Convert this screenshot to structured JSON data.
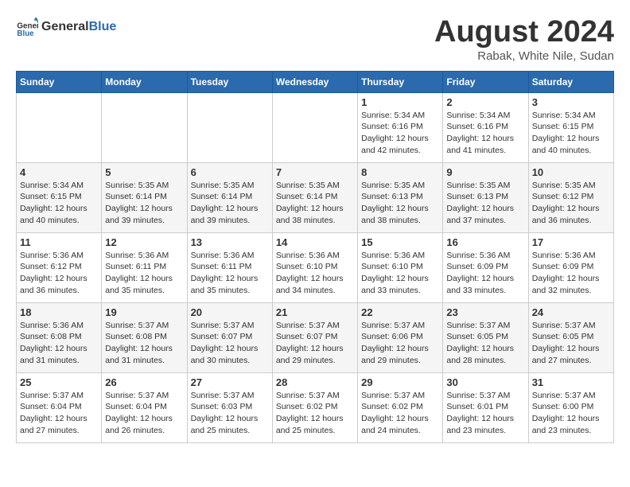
{
  "header": {
    "logo_general": "General",
    "logo_blue": "Blue",
    "month_year": "August 2024",
    "location": "Rabak, White Nile, Sudan"
  },
  "weekdays": [
    "Sunday",
    "Monday",
    "Tuesday",
    "Wednesday",
    "Thursday",
    "Friday",
    "Saturday"
  ],
  "weeks": [
    [
      {
        "day": "",
        "info": ""
      },
      {
        "day": "",
        "info": ""
      },
      {
        "day": "",
        "info": ""
      },
      {
        "day": "",
        "info": ""
      },
      {
        "day": "1",
        "info": "Sunrise: 5:34 AM\nSunset: 6:16 PM\nDaylight: 12 hours\nand 42 minutes."
      },
      {
        "day": "2",
        "info": "Sunrise: 5:34 AM\nSunset: 6:16 PM\nDaylight: 12 hours\nand 41 minutes."
      },
      {
        "day": "3",
        "info": "Sunrise: 5:34 AM\nSunset: 6:15 PM\nDaylight: 12 hours\nand 40 minutes."
      }
    ],
    [
      {
        "day": "4",
        "info": "Sunrise: 5:34 AM\nSunset: 6:15 PM\nDaylight: 12 hours\nand 40 minutes."
      },
      {
        "day": "5",
        "info": "Sunrise: 5:35 AM\nSunset: 6:14 PM\nDaylight: 12 hours\nand 39 minutes."
      },
      {
        "day": "6",
        "info": "Sunrise: 5:35 AM\nSunset: 6:14 PM\nDaylight: 12 hours\nand 39 minutes."
      },
      {
        "day": "7",
        "info": "Sunrise: 5:35 AM\nSunset: 6:14 PM\nDaylight: 12 hours\nand 38 minutes."
      },
      {
        "day": "8",
        "info": "Sunrise: 5:35 AM\nSunset: 6:13 PM\nDaylight: 12 hours\nand 38 minutes."
      },
      {
        "day": "9",
        "info": "Sunrise: 5:35 AM\nSunset: 6:13 PM\nDaylight: 12 hours\nand 37 minutes."
      },
      {
        "day": "10",
        "info": "Sunrise: 5:35 AM\nSunset: 6:12 PM\nDaylight: 12 hours\nand 36 minutes."
      }
    ],
    [
      {
        "day": "11",
        "info": "Sunrise: 5:36 AM\nSunset: 6:12 PM\nDaylight: 12 hours\nand 36 minutes."
      },
      {
        "day": "12",
        "info": "Sunrise: 5:36 AM\nSunset: 6:11 PM\nDaylight: 12 hours\nand 35 minutes."
      },
      {
        "day": "13",
        "info": "Sunrise: 5:36 AM\nSunset: 6:11 PM\nDaylight: 12 hours\nand 35 minutes."
      },
      {
        "day": "14",
        "info": "Sunrise: 5:36 AM\nSunset: 6:10 PM\nDaylight: 12 hours\nand 34 minutes."
      },
      {
        "day": "15",
        "info": "Sunrise: 5:36 AM\nSunset: 6:10 PM\nDaylight: 12 hours\nand 33 minutes."
      },
      {
        "day": "16",
        "info": "Sunrise: 5:36 AM\nSunset: 6:09 PM\nDaylight: 12 hours\nand 33 minutes."
      },
      {
        "day": "17",
        "info": "Sunrise: 5:36 AM\nSunset: 6:09 PM\nDaylight: 12 hours\nand 32 minutes."
      }
    ],
    [
      {
        "day": "18",
        "info": "Sunrise: 5:36 AM\nSunset: 6:08 PM\nDaylight: 12 hours\nand 31 minutes."
      },
      {
        "day": "19",
        "info": "Sunrise: 5:37 AM\nSunset: 6:08 PM\nDaylight: 12 hours\nand 31 minutes."
      },
      {
        "day": "20",
        "info": "Sunrise: 5:37 AM\nSunset: 6:07 PM\nDaylight: 12 hours\nand 30 minutes."
      },
      {
        "day": "21",
        "info": "Sunrise: 5:37 AM\nSunset: 6:07 PM\nDaylight: 12 hours\nand 29 minutes."
      },
      {
        "day": "22",
        "info": "Sunrise: 5:37 AM\nSunset: 6:06 PM\nDaylight: 12 hours\nand 29 minutes."
      },
      {
        "day": "23",
        "info": "Sunrise: 5:37 AM\nSunset: 6:05 PM\nDaylight: 12 hours\nand 28 minutes."
      },
      {
        "day": "24",
        "info": "Sunrise: 5:37 AM\nSunset: 6:05 PM\nDaylight: 12 hours\nand 27 minutes."
      }
    ],
    [
      {
        "day": "25",
        "info": "Sunrise: 5:37 AM\nSunset: 6:04 PM\nDaylight: 12 hours\nand 27 minutes."
      },
      {
        "day": "26",
        "info": "Sunrise: 5:37 AM\nSunset: 6:04 PM\nDaylight: 12 hours\nand 26 minutes."
      },
      {
        "day": "27",
        "info": "Sunrise: 5:37 AM\nSunset: 6:03 PM\nDaylight: 12 hours\nand 25 minutes."
      },
      {
        "day": "28",
        "info": "Sunrise: 5:37 AM\nSunset: 6:02 PM\nDaylight: 12 hours\nand 25 minutes."
      },
      {
        "day": "29",
        "info": "Sunrise: 5:37 AM\nSunset: 6:02 PM\nDaylight: 12 hours\nand 24 minutes."
      },
      {
        "day": "30",
        "info": "Sunrise: 5:37 AM\nSunset: 6:01 PM\nDaylight: 12 hours\nand 23 minutes."
      },
      {
        "day": "31",
        "info": "Sunrise: 5:37 AM\nSunset: 6:00 PM\nDaylight: 12 hours\nand 23 minutes."
      }
    ]
  ]
}
